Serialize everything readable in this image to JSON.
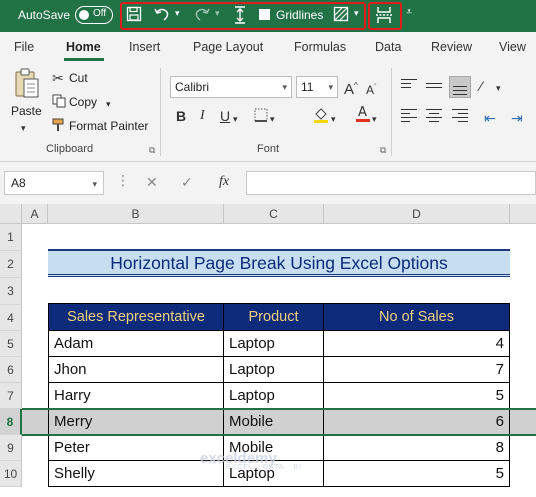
{
  "titlebar": {
    "autosave_label": "AutoSave",
    "autosave_state": "Off",
    "gridlines_label": "Gridlines",
    "highlight_color": "#e21b1b",
    "background": "#217346"
  },
  "tabs": [
    "File",
    "Home",
    "Insert",
    "Page Layout",
    "Formulas",
    "Data",
    "Review",
    "View"
  ],
  "ribbon": {
    "clipboard": {
      "label": "Clipboard",
      "paste": "Paste",
      "cut": "Cut",
      "copy": "Copy",
      "format_painter": "Format Painter"
    },
    "font": {
      "label": "Font",
      "font_name": "Calibri",
      "font_size": "11"
    }
  },
  "formula_bar": {
    "name_box": "A8",
    "fx": "fx"
  },
  "sheet": {
    "columns": [
      "A",
      "B",
      "C",
      "D"
    ],
    "rows": [
      "1",
      "2",
      "3",
      "4",
      "5",
      "6",
      "7",
      "8",
      "9",
      "10"
    ],
    "title": "Horizontal Page Break Using Excel Options",
    "headers": [
      "Sales Representative",
      "Product",
      "No of Sales"
    ],
    "data": [
      [
        "Adam",
        "Laptop",
        "4"
      ],
      [
        "Jhon",
        "Laptop",
        "7"
      ],
      [
        "Harry",
        "Laptop",
        "5"
      ],
      [
        "Merry",
        "Mobile",
        "6"
      ],
      [
        "Peter",
        "Mobile",
        "8"
      ],
      [
        "Shelly",
        "Laptop",
        "5"
      ]
    ],
    "selected_row": "8",
    "header_bg": "#0e2a7a",
    "header_fg": "#f1d07a",
    "title_bg": "#c7def0"
  },
  "watermark": {
    "brand": "exceldemy",
    "tagline": "EXCEL · DATA · BI"
  }
}
